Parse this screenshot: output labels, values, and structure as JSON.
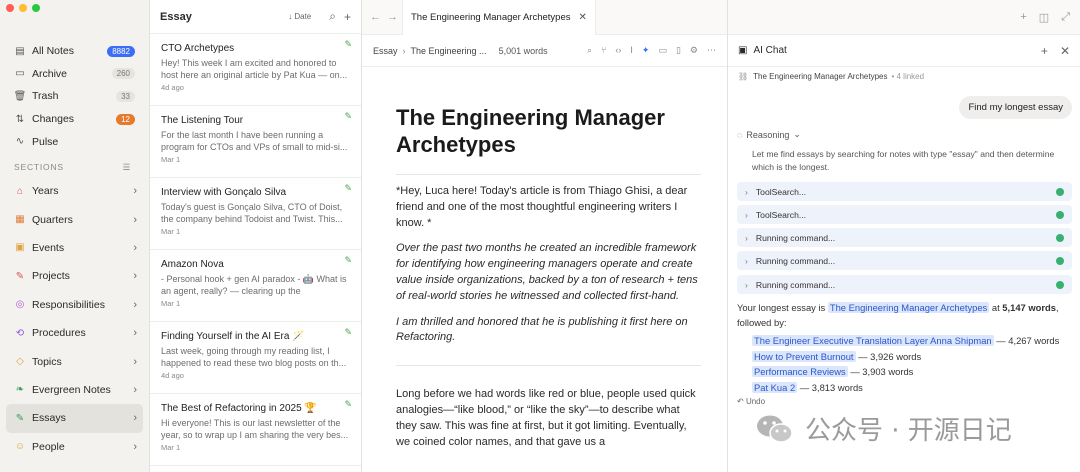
{
  "sidebar": {
    "top": [
      {
        "label": "All Notes",
        "count": "8882",
        "icon": "notes-icon",
        "style": "blue"
      },
      {
        "label": "Archive",
        "count": "260",
        "icon": "archive-icon",
        "style": "gray"
      },
      {
        "label": "Trash",
        "count": "33",
        "icon": "trash-icon",
        "style": "gray"
      },
      {
        "label": "Changes",
        "count": "12",
        "icon": "changes-icon",
        "style": "orange"
      },
      {
        "label": "Pulse",
        "count": "",
        "icon": "pulse-icon",
        "style": ""
      }
    ],
    "sections_label": "SECTIONS",
    "sections": [
      {
        "label": "Years",
        "icon": "years-icon",
        "color": "#d9534f"
      },
      {
        "label": "Quarters",
        "icon": "quarters-icon",
        "color": "#e07b39"
      },
      {
        "label": "Events",
        "icon": "events-icon",
        "color": "#e0a23a"
      },
      {
        "label": "Projects",
        "icon": "projects-icon",
        "color": "#d9534f"
      },
      {
        "label": "Responsibilities",
        "icon": "responsibilities-icon",
        "color": "#b05ad6"
      },
      {
        "label": "Procedures",
        "icon": "procedures-icon",
        "color": "#8a5ad6"
      },
      {
        "label": "Topics",
        "icon": "topics-icon",
        "color": "#e0a23a"
      },
      {
        "label": "Evergreen Notes",
        "icon": "evergreen-icon",
        "color": "#3a9a5a"
      },
      {
        "label": "Essays",
        "icon": "essays-icon",
        "color": "#3a9a5a"
      },
      {
        "label": "People",
        "icon": "people-icon",
        "color": "#e0a23a"
      }
    ]
  },
  "list": {
    "title": "Essay",
    "sort_label": "Date",
    "notes": [
      {
        "title": "CTO Archetypes",
        "preview": "Hey! This week I am excited and honored to host here an original article by Pat Kua — on...",
        "date": "4d ago"
      },
      {
        "title": "The Listening Tour",
        "preview": "For the last month I have been running a program for CTOs and VPs of small to mid-si...",
        "date": "Mar 1"
      },
      {
        "title": "Interview with Gonçalo Silva",
        "preview": "Today's guest is Gonçalo Silva, CTO of Doist, the company behind Todoist and Twist. This...",
        "date": "Mar 1"
      },
      {
        "title": "Amazon Nova",
        "preview": "- Personal hook + gen AI paradox - 🤖 What is an agent, really? — clearing up the confusion...",
        "date": "Mar 1"
      },
      {
        "title": "Finding Yourself in the AI Era 🪄",
        "preview": "Last week, going through my reading list, I happened to read these two blog posts on th...",
        "date": "4d ago"
      },
      {
        "title": "The Best of Refactoring in 2025 🏆",
        "preview": "Hi everyone! This is our last newsletter of the year, so to wrap up I am sharing the very bes...",
        "date": "Mar 1"
      }
    ]
  },
  "editor": {
    "tab_title": "The Engineering Manager Archetypes",
    "crumb_root": "Essay",
    "crumb_current": "The Engineering ...",
    "word_count": "5,001 words",
    "title": "The Engineering Manager Archetypes",
    "intro": "*Hey, Luca here! Today's article is from Thiago Ghisi, a dear friend and one of the most thoughtful engineering writers I know. *",
    "para1": "Over the past two months he created an incredible framework for identifying how engineering managers operate and create value inside organizations, backed by a ton of research + tens of real-world stories he witnessed and collected first-hand.",
    "para2": "I am thrilled and honored that he is publishing it first here on Refactoring.",
    "body": "Long before we had words like red or blue, people used quick analogies—“like blood,” or “like the sky”—to describe what they saw. This was fine at first, but it got limiting. Eventually, we coined color names, and that gave us a"
  },
  "ai": {
    "title": "AI Chat",
    "linked_note": "The Engineering Manager Archetypes",
    "linked_count": "• 4 linked",
    "user_message": "Find my longest essay",
    "reasoning_label": "Reasoning",
    "reasoning_text": "Let me find essays by searching for notes with type \"essay\" and then determine which is the longest.",
    "tools": [
      "ToolSearch...",
      "ToolSearch...",
      "Running command...",
      "Running command...",
      "Running command..."
    ],
    "answer_prefix": "Your longest essay is",
    "answer_link": "The Engineering Manager Archetypes",
    "answer_at": "at",
    "answer_words": "5,147 words",
    "answer_suffix": ", followed by:",
    "results": [
      {
        "title": "The Engineer Executive Translation Layer Anna Shipman",
        "words": "— 4,267 words"
      },
      {
        "title": "How to Prevent Burnout",
        "words": "— 3,926 words"
      },
      {
        "title": "Performance Reviews",
        "words": "— 3,903 words"
      },
      {
        "title": "Pat Kua 2",
        "words": "— 3,813 words"
      }
    ],
    "undo_label": "Undo"
  },
  "watermark": {
    "text": "公众号 · 开源日记"
  }
}
